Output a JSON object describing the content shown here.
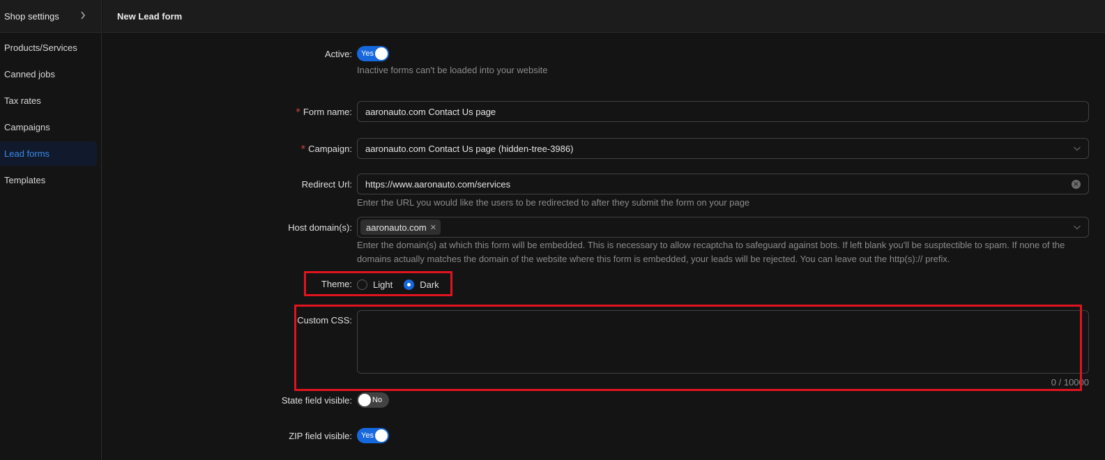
{
  "sidebar": {
    "header": "Shop settings",
    "header_chevron": "chevron-right-icon",
    "items": [
      {
        "label": "Products/Services",
        "active": false
      },
      {
        "label": "Canned jobs",
        "active": false
      },
      {
        "label": "Tax rates",
        "active": false
      },
      {
        "label": "Campaigns",
        "active": false
      },
      {
        "label": "Lead forms",
        "active": true
      },
      {
        "label": "Templates",
        "active": false
      }
    ]
  },
  "page": {
    "title": "New Lead form"
  },
  "form": {
    "active": {
      "label": "Active:",
      "value": "Yes",
      "help": "Inactive forms can't be loaded into your website"
    },
    "form_name": {
      "required_mark": "*",
      "label": "Form name:",
      "value": "aaronauto.com Contact Us page"
    },
    "campaign": {
      "required_mark": "*",
      "label": "Campaign:",
      "value": "aaronauto.com Contact Us page (hidden-tree-3986)"
    },
    "redirect_url": {
      "label": "Redirect Url:",
      "value": "https://www.aaronauto.com/services",
      "help": "Enter the URL you would like the users to be redirected to after they submit the form on your page"
    },
    "host_domains": {
      "label": "Host domain(s):",
      "tags": [
        "aaronauto.com"
      ],
      "help_line1": "Enter the domain(s) at which this form will be embedded. This is necessary to allow recaptcha to safeguard against bots. If left blank you'll be susptectible to spam. If none of the",
      "help_line2": "domains actually matches the domain of the website where this form is embedded, your leads will be rejected. You can leave out the http(s):// prefix."
    },
    "theme": {
      "label": "Theme:",
      "options": [
        "Light",
        "Dark"
      ],
      "selected": "Dark"
    },
    "custom_css": {
      "label": "Custom CSS:",
      "value": "",
      "counter": "0 / 10000"
    },
    "state_field": {
      "label": "State field visible:",
      "value": "No"
    },
    "zip_field": {
      "label": "ZIP field visible:",
      "value": "Yes"
    }
  },
  "colors": {
    "accent": "#1668dc",
    "highlight": "#e0141e"
  }
}
